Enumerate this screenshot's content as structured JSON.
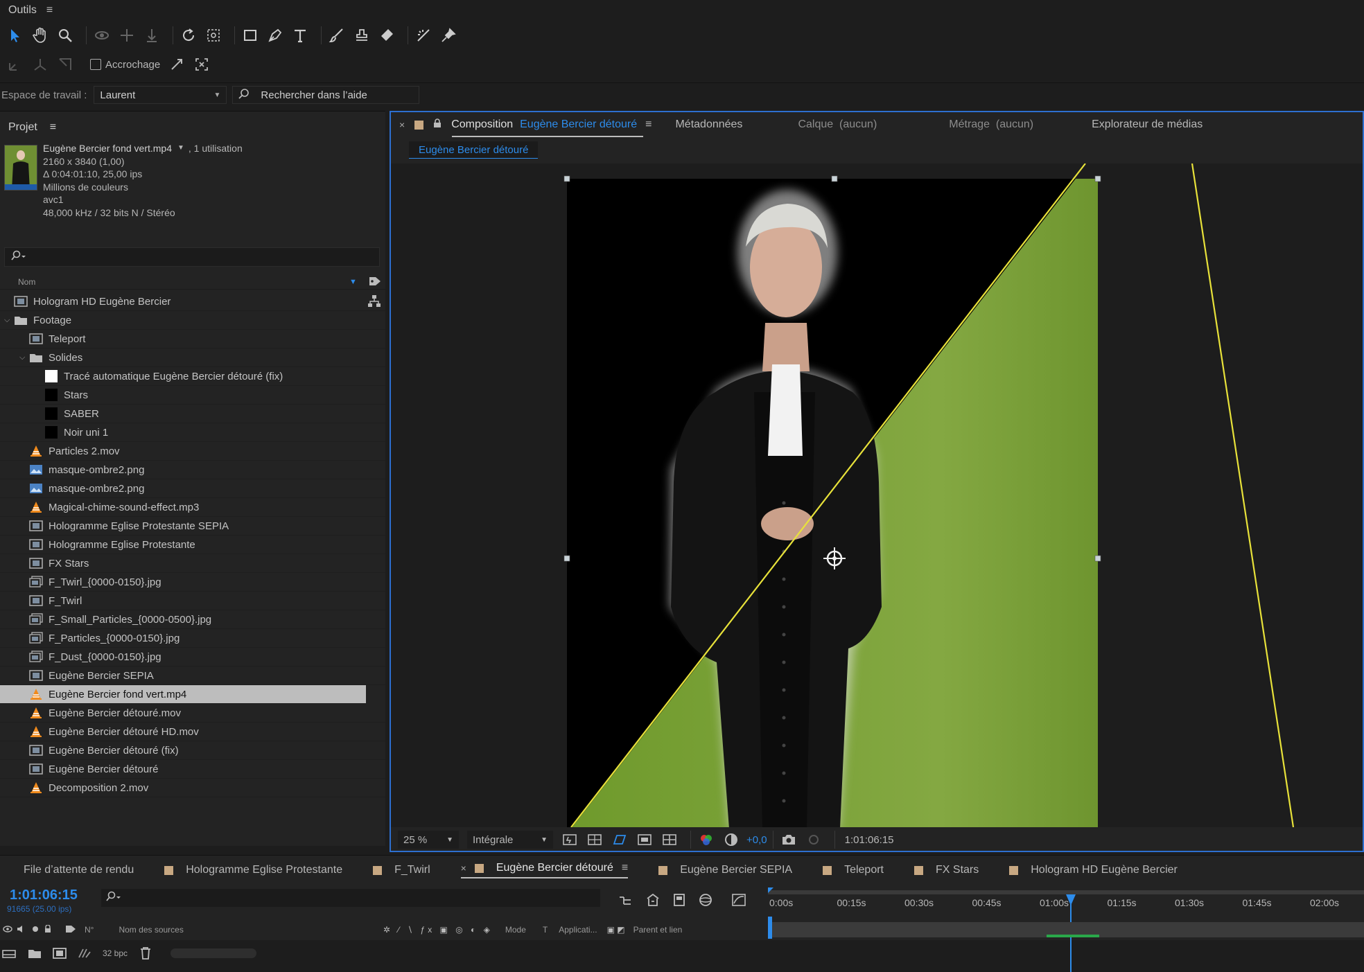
{
  "tools": {
    "title": "Outils",
    "snap_label": "Accrochage"
  },
  "workspace": {
    "label": "Espace de travail :",
    "value": "Laurent",
    "search_placeholder": "Rechercher dans l’aide"
  },
  "project": {
    "title": "Projet",
    "selected_file": "Eugène Bercier fond vert.mp4",
    "usage": ", 1 utilisation",
    "info": [
      "2160 x 3840 (1,00)",
      "Δ 0:04:01:10, 25,00 ips",
      "Millions de couleurs",
      "avc1",
      "48,000 kHz / 32 bits N / Stéréo"
    ],
    "col_name": "Nom",
    "bpc": "32 bpc",
    "items": [
      {
        "label": "Hologram HD Eugène Bercier",
        "indent": 0,
        "type": "comp"
      },
      {
        "label": "Footage",
        "indent": 0,
        "type": "folder",
        "open": true
      },
      {
        "label": "Teleport",
        "indent": 1,
        "type": "comp"
      },
      {
        "label": "Solides",
        "indent": 1,
        "type": "folder",
        "open": true
      },
      {
        "label": "Tracé automatique Eugène Bercier détouré (fix)",
        "indent": 2,
        "type": "solid-white"
      },
      {
        "label": "Stars",
        "indent": 2,
        "type": "solid-black"
      },
      {
        "label": "SABER",
        "indent": 2,
        "type": "solid-black"
      },
      {
        "label": "Noir uni 1",
        "indent": 2,
        "type": "solid-black"
      },
      {
        "label": "Particles 2.mov",
        "indent": 1,
        "type": "vlc"
      },
      {
        "label": "masque-ombre2.png",
        "indent": 1,
        "type": "image"
      },
      {
        "label": "masque-ombre2.png",
        "indent": 1,
        "type": "image"
      },
      {
        "label": "Magical-chime-sound-effect.mp3",
        "indent": 1,
        "type": "vlc"
      },
      {
        "label": "Hologramme Eglise Protestante SEPIA",
        "indent": 1,
        "type": "comp"
      },
      {
        "label": "Hologramme Eglise Protestante",
        "indent": 1,
        "type": "comp"
      },
      {
        "label": "FX Stars",
        "indent": 1,
        "type": "comp"
      },
      {
        "label": "F_Twirl_{0000-0150}.jpg",
        "indent": 1,
        "type": "sequence"
      },
      {
        "label": "F_Twirl",
        "indent": 1,
        "type": "comp"
      },
      {
        "label": "F_Small_Particles_{0000-0500}.jpg",
        "indent": 1,
        "type": "sequence"
      },
      {
        "label": "F_Particles_{0000-0150}.jpg",
        "indent": 1,
        "type": "sequence"
      },
      {
        "label": "F_Dust_{0000-0150}.jpg",
        "indent": 1,
        "type": "sequence"
      },
      {
        "label": "Eugène Bercier SEPIA",
        "indent": 1,
        "type": "comp"
      },
      {
        "label": "Eugène Bercier fond vert.mp4",
        "indent": 1,
        "type": "vlc",
        "selected": true
      },
      {
        "label": "Eugène Bercier détouré.mov",
        "indent": 1,
        "type": "vlc"
      },
      {
        "label": "Eugène Bercier détouré HD.mov",
        "indent": 1,
        "type": "vlc"
      },
      {
        "label": "Eugène Bercier détouré (fix)",
        "indent": 1,
        "type": "comp"
      },
      {
        "label": "Eugène Bercier détouré",
        "indent": 1,
        "type": "comp"
      },
      {
        "label": "Decomposition 2.mov",
        "indent": 1,
        "type": "vlc"
      }
    ]
  },
  "composition": {
    "tab_prefix": "Composition",
    "tab_name": "Eugène Bercier détouré",
    "other_tabs": [
      "Métadonnées",
      "Calque  (aucun)",
      "Métrage  (aucun)",
      "Explorateur de médias"
    ],
    "subtab": "Eugène Bercier détouré",
    "zoom": "25 %",
    "resolution": "Intégrale",
    "exposure": "+0,0",
    "timecode": "1:01:06:15"
  },
  "timeline": {
    "tabs": [
      {
        "label": "File d’attente de rendu",
        "color": null
      },
      {
        "label": "Hologramme Eglise Protestante",
        "color": "#c8a882"
      },
      {
        "label": "F_Twirl",
        "color": "#c8a882"
      },
      {
        "label": "Eugène Bercier détouré",
        "color": "#c8a882",
        "active": true
      },
      {
        "label": "Eugène Bercier SEPIA",
        "color": "#c8a882"
      },
      {
        "label": "Teleport",
        "color": "#c8a882"
      },
      {
        "label": "FX Stars",
        "color": "#c8a882"
      },
      {
        "label": "Hologram HD Eugène Bercier",
        "color": "#c8a882"
      }
    ],
    "timecode": "1:01:06:15",
    "frames": "91665 (25.00 ips)",
    "ruler": [
      "0:00s",
      "00:15s",
      "00:30s",
      "00:45s",
      "01:00s",
      "01:15s",
      "01:30s",
      "01:45s",
      "02:00s"
    ],
    "cols": {
      "num": "N°",
      "source": "Nom des sources",
      "mode": "Mode",
      "t": "T",
      "app": "Applicati...",
      "parent": "Parent et lien"
    }
  },
  "colors": {
    "accent": "#2d8ceb",
    "green_screen": "#7fa33a",
    "guide_line": "#e8e23a"
  }
}
